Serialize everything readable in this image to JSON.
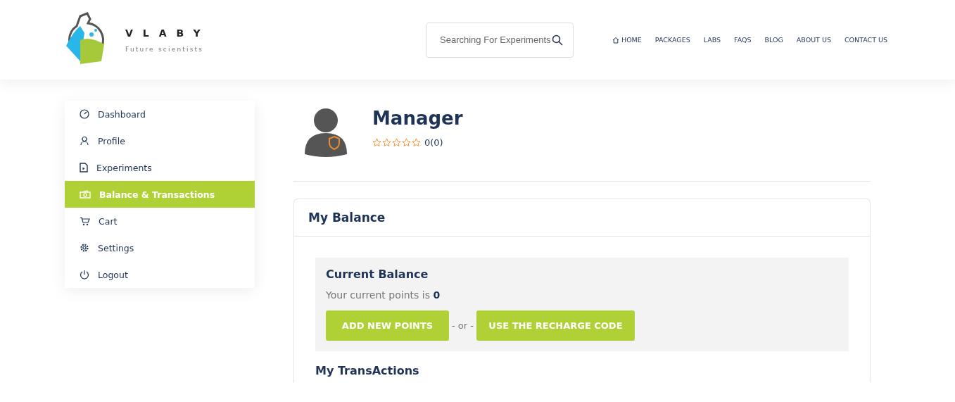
{
  "header": {
    "brand": {
      "name": "VLABY",
      "tagline": "Future scientists"
    },
    "search": {
      "placeholder": "Searching For Experiments"
    },
    "nav": [
      {
        "label": "HOME"
      },
      {
        "label": "PACKAGES"
      },
      {
        "label": "LABS"
      },
      {
        "label": "FAQS"
      },
      {
        "label": "BLOG"
      },
      {
        "label": "ABOUT US"
      },
      {
        "label": "CONTACT US"
      }
    ]
  },
  "sidebar": {
    "items": [
      {
        "label": "Dashboard",
        "selected": false
      },
      {
        "label": "Profile",
        "selected": false
      },
      {
        "label": "Experiments",
        "selected": false
      },
      {
        "label": "Balance & Transactions",
        "selected": true
      },
      {
        "label": "Cart",
        "selected": false
      },
      {
        "label": "Settings",
        "selected": false
      },
      {
        "label": "Logout",
        "selected": false
      }
    ]
  },
  "profile": {
    "name": "Manager",
    "stars": 0,
    "rating": "0(0)"
  },
  "balance_card": {
    "title": "My Balance",
    "current_balance": {
      "title": "Current Balance",
      "text": "Your current points is **0**",
      "buttons": [
        "ADD NEW POINTS",
        "USE THE RECHARGE CODE"
      ],
      "separator": "- or -"
    },
    "transactions_title": "My TransActions"
  }
}
